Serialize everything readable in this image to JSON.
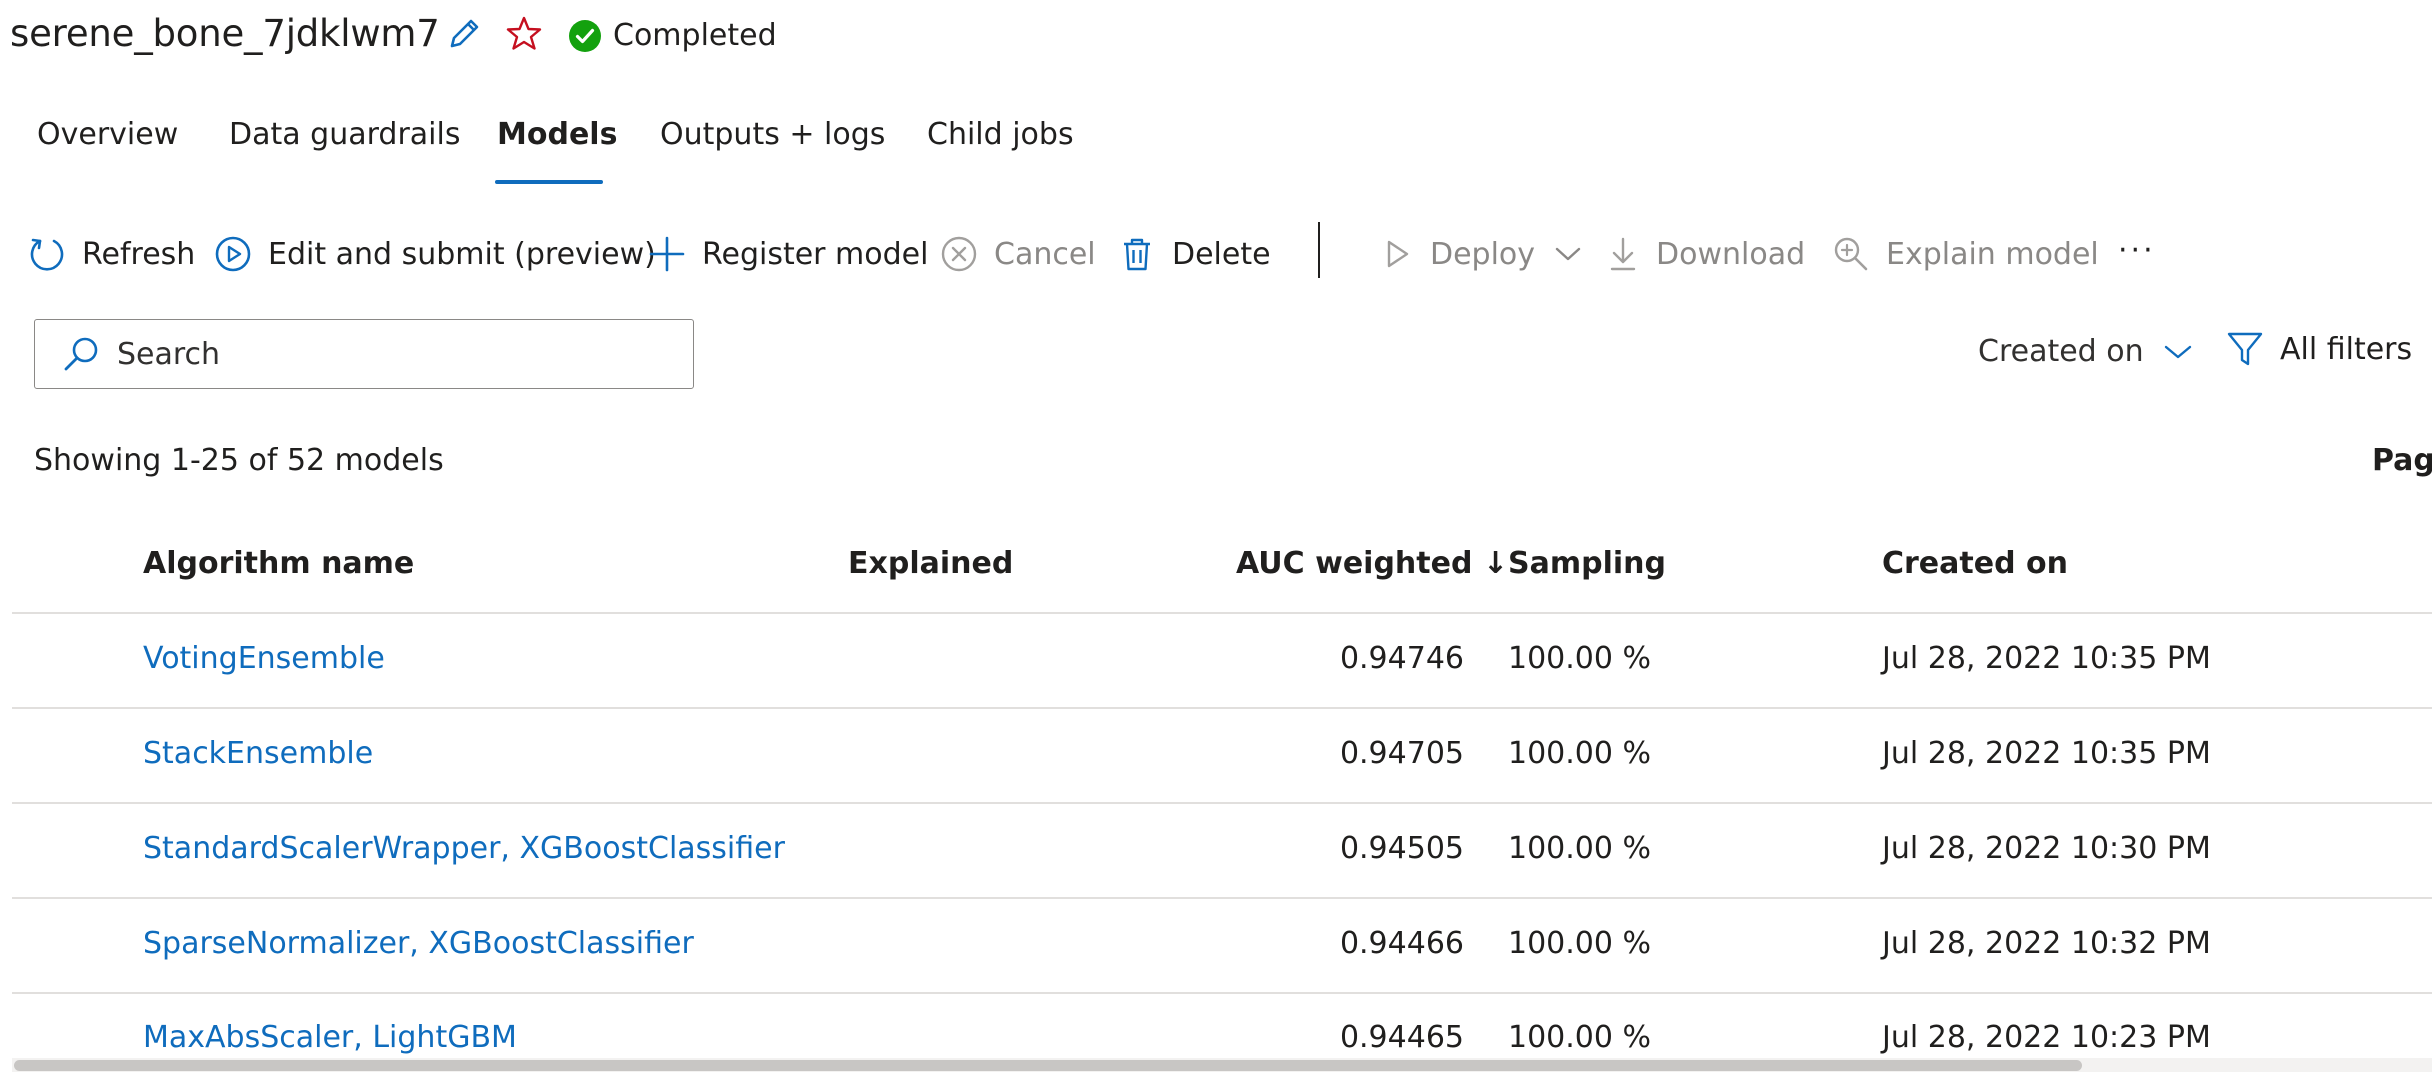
{
  "header": {
    "job_name": "serene_bone_7jdklwm7",
    "status": "Completed",
    "icons": [
      "edit-pencil-icon",
      "favorite-star-icon",
      "status-check-icon"
    ]
  },
  "tabs": [
    {
      "label": "Overview",
      "active": false
    },
    {
      "label": "Data guardrails",
      "active": false
    },
    {
      "label": "Models",
      "active": true
    },
    {
      "label": "Outputs + logs",
      "active": false
    },
    {
      "label": "Child jobs",
      "active": false
    }
  ],
  "toolbar": {
    "refresh": "Refresh",
    "edit_submit": "Edit and submit (preview)",
    "register_model": "Register model",
    "cancel": "Cancel",
    "delete": "Delete",
    "deploy": "Deploy",
    "download": "Download",
    "explain_model": "Explain model",
    "more": "···"
  },
  "search": {
    "placeholder": "Search",
    "value": ""
  },
  "sort": {
    "label": "Created on"
  },
  "filters": {
    "label": "All filters"
  },
  "summary": {
    "showing": "Showing 1-25 of 52 models",
    "page_label": "Page"
  },
  "table": {
    "columns": {
      "algorithm": "Algorithm name",
      "explained": "Explained",
      "auc": "AUC weighted ↓",
      "sampling": "Sampling",
      "created": "Created on"
    },
    "rows": [
      {
        "algorithm": "VotingEnsemble",
        "explained": "",
        "auc": "0.94746",
        "sampling": "100.00 %",
        "created": "Jul 28, 2022 10:35 PM"
      },
      {
        "algorithm": "StackEnsemble",
        "explained": "",
        "auc": "0.94705",
        "sampling": "100.00 %",
        "created": "Jul 28, 2022 10:35 PM"
      },
      {
        "algorithm": "StandardScalerWrapper, XGBoostClassifier",
        "explained": "",
        "auc": "0.94505",
        "sampling": "100.00 %",
        "created": "Jul 28, 2022 10:30 PM"
      },
      {
        "algorithm": "SparseNormalizer, XGBoostClassifier",
        "explained": "",
        "auc": "0.94466",
        "sampling": "100.00 %",
        "created": "Jul 28, 2022 10:32 PM"
      },
      {
        "algorithm": "MaxAbsScaler, LightGBM",
        "explained": "",
        "auc": "0.94465",
        "sampling": "100.00 %",
        "created": "Jul 28, 2022 10:23 PM"
      }
    ]
  },
  "colors": {
    "accent": "#0f6cbd",
    "link": "#0f6cbd",
    "status_success": "#13a10e",
    "star": "#c50f1f",
    "disabled": "#8a8886"
  }
}
